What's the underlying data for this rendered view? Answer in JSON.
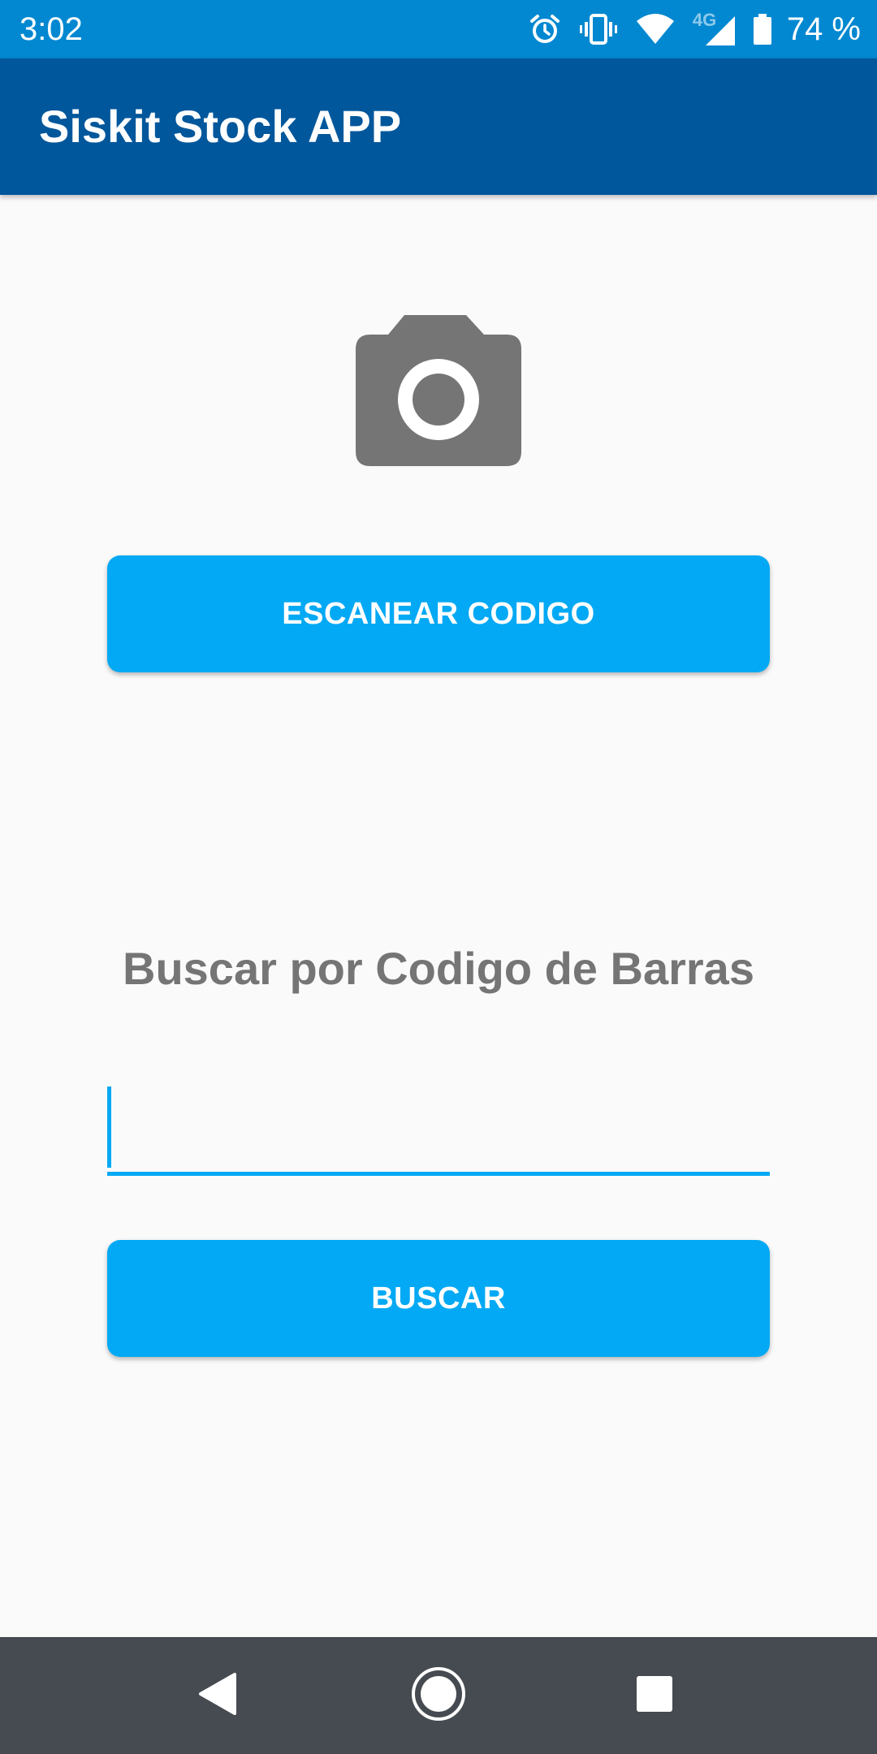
{
  "status_bar": {
    "time": "3:02",
    "network_label": "4G",
    "battery_percent": "74 %",
    "icons": [
      "alarm-icon",
      "vibrate-icon",
      "wifi-icon",
      "cell-signal-icon",
      "battery-icon"
    ]
  },
  "app_bar": {
    "title": "Siskit Stock APP"
  },
  "main": {
    "camera_icon": "camera-icon",
    "scan_button_label": "ESCANEAR CODIGO",
    "search_section_title": "Buscar por Codigo de Barras",
    "barcode_input": {
      "value": "",
      "placeholder": ""
    },
    "search_button_label": "BUSCAR"
  },
  "nav_bar": {
    "icons": [
      "back-icon",
      "home-icon",
      "recents-icon"
    ]
  },
  "colors": {
    "status_bar": "#0288D1",
    "app_bar": "#01579B",
    "accent": "#03A9F4",
    "background": "#FAFAFA",
    "section_title": "#757575",
    "camera_icon": "#757575",
    "nav_bar": "#454B50"
  }
}
